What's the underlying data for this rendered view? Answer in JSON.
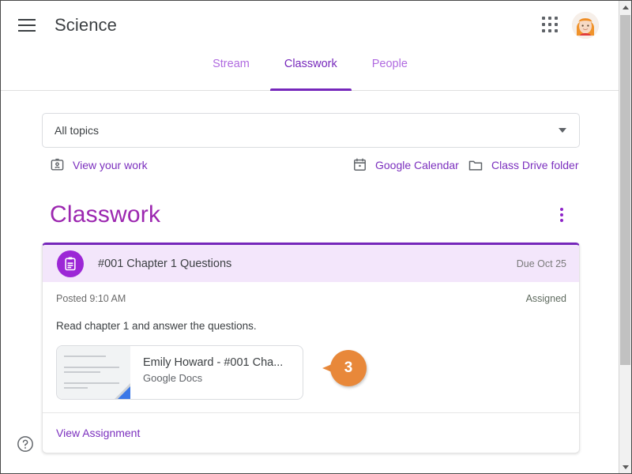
{
  "app": {
    "course_title": "Science",
    "menu_icon": "hamburger-menu-icon",
    "apps_icon": "google-apps-grid-icon",
    "avatar_icon": "user-avatar"
  },
  "tabs": [
    {
      "label": "Stream",
      "active": false
    },
    {
      "label": "Classwork",
      "active": true
    },
    {
      "label": "People",
      "active": false
    }
  ],
  "filter": {
    "topics_label": "All topics",
    "chevron_icon": "chevron-down-icon"
  },
  "links": {
    "view_your_work": "View your work",
    "view_your_work_icon": "id-badge-icon",
    "google_calendar": "Google Calendar",
    "google_calendar_icon": "calendar-icon",
    "class_drive_folder": "Class Drive folder",
    "class_drive_folder_icon": "folder-icon"
  },
  "classwork": {
    "heading": "Classwork",
    "overflow_icon": "more-vert-icon"
  },
  "assignment": {
    "badge_icon": "assignment-clipboard-icon",
    "title": "#001 Chapter 1 Questions",
    "due": "Due Oct 25",
    "posted": "Posted 9:10 AM",
    "status": "Assigned",
    "description": "Read chapter 1 and answer the questions.",
    "footer_link": "View Assignment"
  },
  "attachment": {
    "title": "Emily Howard - #001 Cha...",
    "subtitle": "Google Docs",
    "thumb_icon": "google-docs-thumbnail"
  },
  "callout": {
    "number": "3"
  },
  "footer": {
    "help_icon": "help-circle-icon"
  },
  "scrollbar": {
    "up_icon": "scroll-up-arrow-icon",
    "down_icon": "scroll-down-arrow-icon"
  },
  "colors": {
    "brand_purple": "#7627bb",
    "heading_purple": "#9c27b0",
    "tab_inactive": "#b06ae0",
    "card_header_bg": "#f3e6fb",
    "callout_orange": "#e8883a",
    "docs_blue": "#3b78e7"
  }
}
